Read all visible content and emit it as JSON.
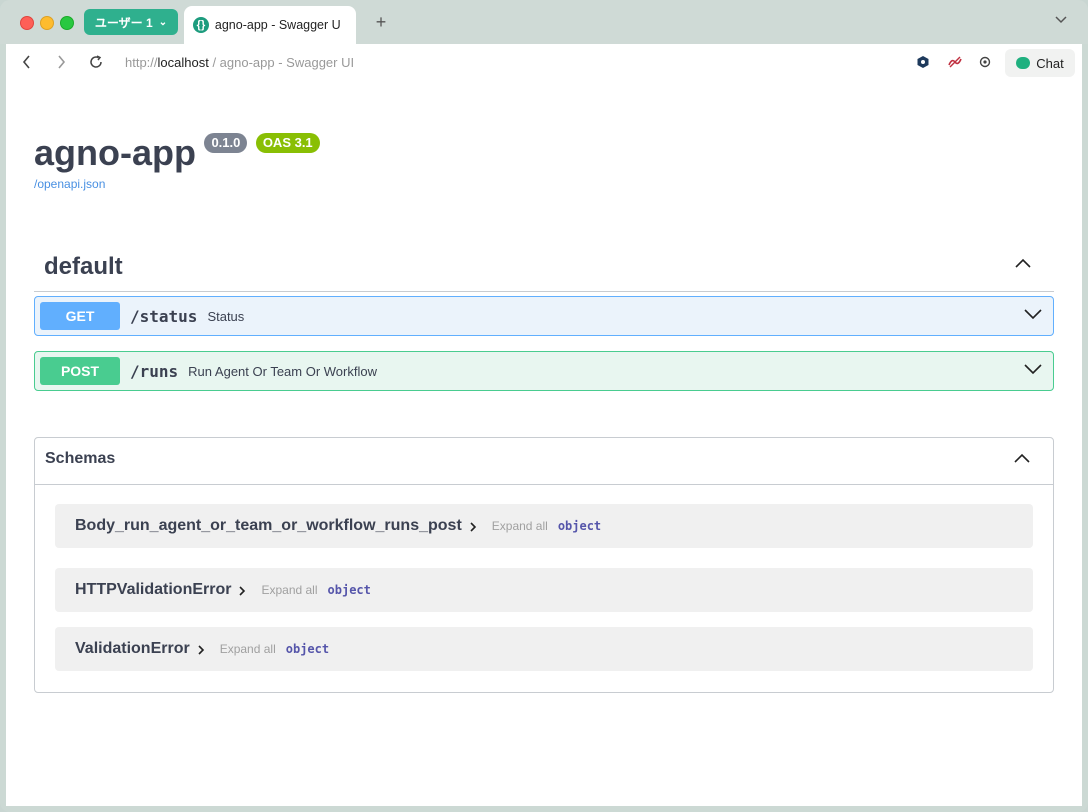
{
  "browser": {
    "profile_label": "ユーザー 1",
    "tab_title": "agno-app - Swagger U",
    "url_scheme": "http://",
    "url_host": "localhost",
    "url_rest": " / agno-app - Swagger UI",
    "chat_label": "Chat",
    "new_tab_glyph": "+",
    "tab_list_glyph": "⌄"
  },
  "info": {
    "title": "agno-app",
    "version": "0.1.0",
    "oas": "OAS 3.1",
    "spec_link": "/openapi.json"
  },
  "tag": {
    "name": "default",
    "operations": [
      {
        "method": "GET",
        "path": "/status",
        "summary": "Status"
      },
      {
        "method": "POST",
        "path": "/runs",
        "summary": "Run Agent Or Team Or Workflow"
      }
    ]
  },
  "schemas": {
    "title": "Schemas",
    "models": [
      {
        "name": "Body_run_agent_or_team_or_workflow_runs_post",
        "expand": "Expand all",
        "type": "object"
      },
      {
        "name": "HTTPValidationError",
        "expand": "Expand all",
        "type": "object"
      },
      {
        "name": "ValidationError",
        "expand": "Expand all",
        "type": "object"
      }
    ]
  },
  "colors": {
    "get": "#61affe",
    "post": "#49cc90",
    "oas_badge": "#89bf04",
    "version_badge": "#7d8492",
    "profile": "#2fb08e"
  }
}
